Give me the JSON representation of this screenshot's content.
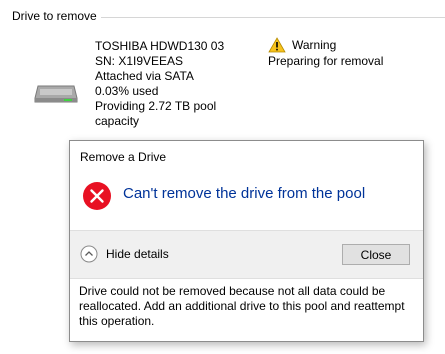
{
  "section": {
    "title": "Drive to remove"
  },
  "drive": {
    "icon": "hard-drive-icon",
    "model": "TOSHIBA HDWD130 03",
    "serial": "SN: X1I9VEEAS",
    "connection": "Attached via SATA",
    "usage": "0.03% used",
    "capacity": "Providing 2.72 TB pool capacity"
  },
  "status": {
    "icon": "warning-icon",
    "label": "Warning",
    "detail": "Preparing for removal"
  },
  "dialog": {
    "title": "Remove a Drive",
    "error_icon": "error-icon",
    "main_instruction": "Can't remove the drive from the pool",
    "toggle_icon": "chevron-up-icon",
    "toggle_label": "Hide details",
    "close_label": "Close",
    "details": "Drive could not be removed because not all data could be reallocated. Add an additional drive to this pool and reattempt this operation."
  },
  "colors": {
    "instruction_text": "#003399",
    "error_red": "#e81123",
    "warning_yellow": "#f7c21c",
    "footer_bg": "#f0f0f0"
  }
}
